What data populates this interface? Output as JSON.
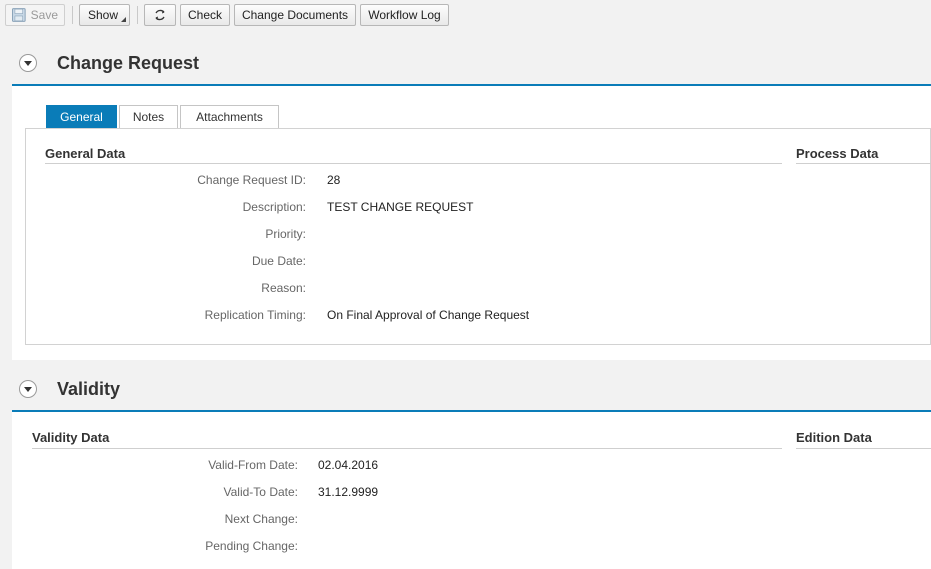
{
  "toolbar": {
    "save_label": "Save",
    "show_label": "Show",
    "check_label": "Check",
    "change_documents_label": "Change Documents",
    "workflow_log_label": "Workflow Log"
  },
  "change_request": {
    "title": "Change Request",
    "tabs": [
      "General",
      "Notes",
      "Attachments"
    ],
    "active_tab": "General",
    "general_data_title": "General Data",
    "process_data_title": "Process Data",
    "fields": [
      {
        "label": "Change Request ID:",
        "value": "28"
      },
      {
        "label": "Description:",
        "value": "TEST CHANGE REQUEST"
      },
      {
        "label": "Priority:",
        "value": ""
      },
      {
        "label": "Due Date:",
        "value": ""
      },
      {
        "label": "Reason:",
        "value": ""
      },
      {
        "label": "Replication Timing:",
        "value": "On Final Approval of Change Request"
      }
    ]
  },
  "validity": {
    "title": "Validity",
    "validity_data_title": "Validity Data",
    "edition_data_title": "Edition Data",
    "fields": [
      {
        "label": "Valid-From Date:",
        "value": "02.04.2016"
      },
      {
        "label": "Valid-To Date:",
        "value": "31.12.9999"
      },
      {
        "label": "Next Change:",
        "value": ""
      },
      {
        "label": "Pending Change:",
        "value": ""
      }
    ]
  },
  "colors": {
    "accent": "#0a7cb8",
    "header_bg": "#f2f2f2"
  }
}
